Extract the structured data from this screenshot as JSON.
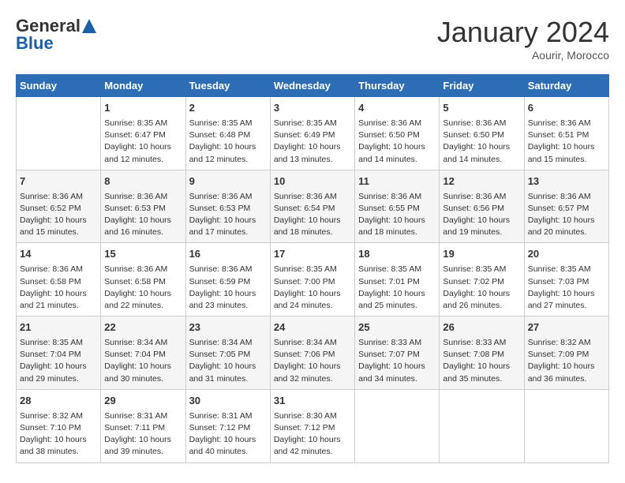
{
  "header": {
    "logo_general": "General",
    "logo_blue": "Blue",
    "month_title": "January 2024",
    "location": "Aourir, Morocco"
  },
  "days_of_week": [
    "Sunday",
    "Monday",
    "Tuesday",
    "Wednesday",
    "Thursday",
    "Friday",
    "Saturday"
  ],
  "weeks": [
    [
      {
        "day": "",
        "content": ""
      },
      {
        "day": "1",
        "content": "Sunrise: 8:35 AM\nSunset: 6:47 PM\nDaylight: 10 hours\nand 12 minutes."
      },
      {
        "day": "2",
        "content": "Sunrise: 8:35 AM\nSunset: 6:48 PM\nDaylight: 10 hours\nand 12 minutes."
      },
      {
        "day": "3",
        "content": "Sunrise: 8:35 AM\nSunset: 6:49 PM\nDaylight: 10 hours\nand 13 minutes."
      },
      {
        "day": "4",
        "content": "Sunrise: 8:36 AM\nSunset: 6:50 PM\nDaylight: 10 hours\nand 14 minutes."
      },
      {
        "day": "5",
        "content": "Sunrise: 8:36 AM\nSunset: 6:50 PM\nDaylight: 10 hours\nand 14 minutes."
      },
      {
        "day": "6",
        "content": "Sunrise: 8:36 AM\nSunset: 6:51 PM\nDaylight: 10 hours\nand 15 minutes."
      }
    ],
    [
      {
        "day": "7",
        "content": "Sunrise: 8:36 AM\nSunset: 6:52 PM\nDaylight: 10 hours\nand 15 minutes."
      },
      {
        "day": "8",
        "content": "Sunrise: 8:36 AM\nSunset: 6:53 PM\nDaylight: 10 hours\nand 16 minutes."
      },
      {
        "day": "9",
        "content": "Sunrise: 8:36 AM\nSunset: 6:53 PM\nDaylight: 10 hours\nand 17 minutes."
      },
      {
        "day": "10",
        "content": "Sunrise: 8:36 AM\nSunset: 6:54 PM\nDaylight: 10 hours\nand 18 minutes."
      },
      {
        "day": "11",
        "content": "Sunrise: 8:36 AM\nSunset: 6:55 PM\nDaylight: 10 hours\nand 18 minutes."
      },
      {
        "day": "12",
        "content": "Sunrise: 8:36 AM\nSunset: 6:56 PM\nDaylight: 10 hours\nand 19 minutes."
      },
      {
        "day": "13",
        "content": "Sunrise: 8:36 AM\nSunset: 6:57 PM\nDaylight: 10 hours\nand 20 minutes."
      }
    ],
    [
      {
        "day": "14",
        "content": "Sunrise: 8:36 AM\nSunset: 6:58 PM\nDaylight: 10 hours\nand 21 minutes."
      },
      {
        "day": "15",
        "content": "Sunrise: 8:36 AM\nSunset: 6:58 PM\nDaylight: 10 hours\nand 22 minutes."
      },
      {
        "day": "16",
        "content": "Sunrise: 8:36 AM\nSunset: 6:59 PM\nDaylight: 10 hours\nand 23 minutes."
      },
      {
        "day": "17",
        "content": "Sunrise: 8:35 AM\nSunset: 7:00 PM\nDaylight: 10 hours\nand 24 minutes."
      },
      {
        "day": "18",
        "content": "Sunrise: 8:35 AM\nSunset: 7:01 PM\nDaylight: 10 hours\nand 25 minutes."
      },
      {
        "day": "19",
        "content": "Sunrise: 8:35 AM\nSunset: 7:02 PM\nDaylight: 10 hours\nand 26 minutes."
      },
      {
        "day": "20",
        "content": "Sunrise: 8:35 AM\nSunset: 7:03 PM\nDaylight: 10 hours\nand 27 minutes."
      }
    ],
    [
      {
        "day": "21",
        "content": "Sunrise: 8:35 AM\nSunset: 7:04 PM\nDaylight: 10 hours\nand 29 minutes."
      },
      {
        "day": "22",
        "content": "Sunrise: 8:34 AM\nSunset: 7:04 PM\nDaylight: 10 hours\nand 30 minutes."
      },
      {
        "day": "23",
        "content": "Sunrise: 8:34 AM\nSunset: 7:05 PM\nDaylight: 10 hours\nand 31 minutes."
      },
      {
        "day": "24",
        "content": "Sunrise: 8:34 AM\nSunset: 7:06 PM\nDaylight: 10 hours\nand 32 minutes."
      },
      {
        "day": "25",
        "content": "Sunrise: 8:33 AM\nSunset: 7:07 PM\nDaylight: 10 hours\nand 34 minutes."
      },
      {
        "day": "26",
        "content": "Sunrise: 8:33 AM\nSunset: 7:08 PM\nDaylight: 10 hours\nand 35 minutes."
      },
      {
        "day": "27",
        "content": "Sunrise: 8:32 AM\nSunset: 7:09 PM\nDaylight: 10 hours\nand 36 minutes."
      }
    ],
    [
      {
        "day": "28",
        "content": "Sunrise: 8:32 AM\nSunset: 7:10 PM\nDaylight: 10 hours\nand 38 minutes."
      },
      {
        "day": "29",
        "content": "Sunrise: 8:31 AM\nSunset: 7:11 PM\nDaylight: 10 hours\nand 39 minutes."
      },
      {
        "day": "30",
        "content": "Sunrise: 8:31 AM\nSunset: 7:12 PM\nDaylight: 10 hours\nand 40 minutes."
      },
      {
        "day": "31",
        "content": "Sunrise: 8:30 AM\nSunset: 7:12 PM\nDaylight: 10 hours\nand 42 minutes."
      },
      {
        "day": "",
        "content": ""
      },
      {
        "day": "",
        "content": ""
      },
      {
        "day": "",
        "content": ""
      }
    ]
  ]
}
